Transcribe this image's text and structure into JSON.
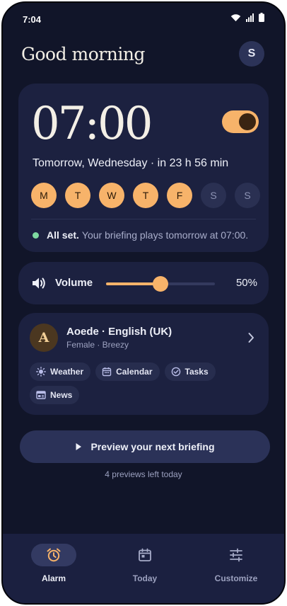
{
  "status_bar": {
    "time": "7:04"
  },
  "header": {
    "greeting": "Good morning",
    "avatar_initial": "S"
  },
  "alarm": {
    "time": "07:00",
    "enabled": true,
    "subtitle": "Tomorrow, Wednesday · in 23 h 56 min",
    "days": [
      {
        "label": "M",
        "active": true
      },
      {
        "label": "T",
        "active": true
      },
      {
        "label": "W",
        "active": true
      },
      {
        "label": "T",
        "active": true
      },
      {
        "label": "F",
        "active": true
      },
      {
        "label": "S",
        "active": false
      },
      {
        "label": "S",
        "active": false
      }
    ],
    "status_bold": "All set.",
    "status_text": "Your briefing plays tomorrow at 07:00."
  },
  "volume": {
    "label": "Volume",
    "value_label": "50%",
    "level": 0.5
  },
  "voice": {
    "initial": "A",
    "title": "Aoede · English (UK)",
    "subtitle": "Female · Breezy",
    "chips": [
      {
        "label": "Weather",
        "icon": "sun-icon"
      },
      {
        "label": "Calendar",
        "icon": "calendar-icon"
      },
      {
        "label": "Tasks",
        "icon": "check-circle-icon"
      },
      {
        "label": "News",
        "icon": "newspaper-icon"
      }
    ]
  },
  "preview": {
    "button_label": "Preview your next briefing",
    "remaining_text": "4 previews left today"
  },
  "nav": {
    "alarm": "Alarm",
    "today": "Today",
    "customize": "Customize",
    "active": "alarm"
  },
  "colors": {
    "accent": "#f7b36a",
    "background": "#111529",
    "card": "#1c2140",
    "success": "#7ed9a0"
  }
}
